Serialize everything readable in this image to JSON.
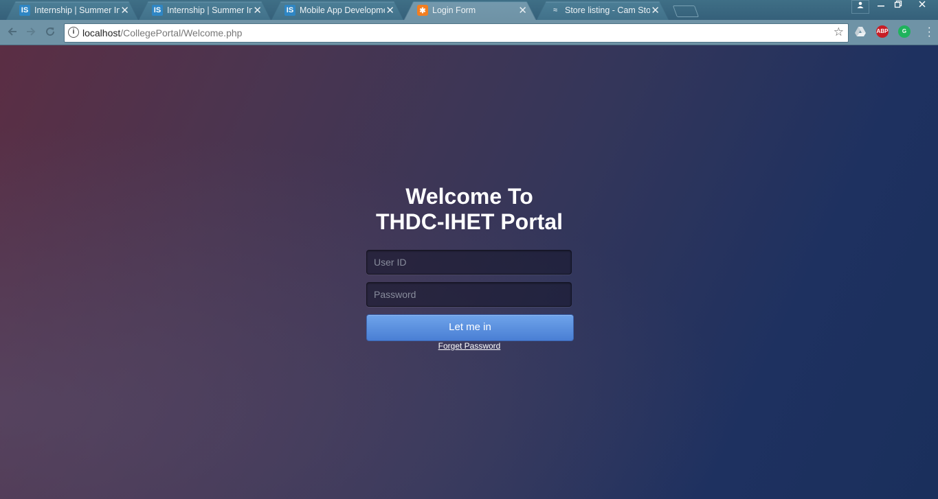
{
  "browser": {
    "tabs": [
      {
        "title": "Internship | Summer Inte",
        "favicon": "IS"
      },
      {
        "title": "Internship | Summer Inte",
        "favicon": "IS"
      },
      {
        "title": "Mobile App Developmen",
        "favicon": "IS"
      },
      {
        "title": "Login Form",
        "favicon": "xampp-icon"
      },
      {
        "title": "Store listing - Cam Store",
        "favicon": "store-icon"
      }
    ],
    "close_glyph": "✕",
    "address": {
      "host": "localhost",
      "path": "/CollegePortal/Welcome.php"
    },
    "extensions": {
      "abp_label": "ABP"
    }
  },
  "page": {
    "heading_line1": "Welcome To",
    "heading_line2": "THDC-IHET Portal",
    "userid_placeholder": "User ID",
    "password_placeholder": "Password",
    "login_button": "Let me in",
    "forgot_link": "Forget Password"
  },
  "colors": {
    "button_top": "#6ea3ea",
    "button_bottom": "#4a7fd4",
    "page_bg_left": "#5b2e44",
    "page_bg_right": "#1a2f5c"
  }
}
